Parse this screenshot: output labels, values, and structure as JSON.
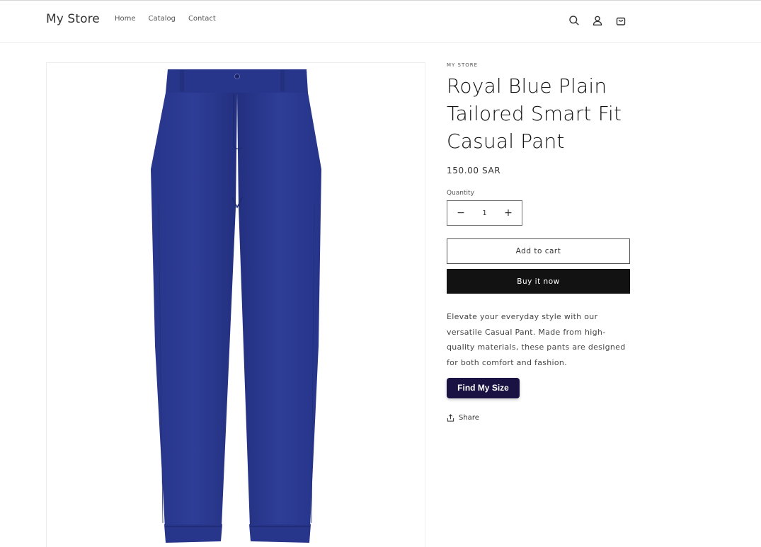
{
  "header": {
    "store_name": "My Store",
    "nav": [
      "Home",
      "Catalog",
      "Contact"
    ],
    "icons": [
      "search-icon",
      "account-icon",
      "cart-icon"
    ]
  },
  "product": {
    "vendor": "MY STORE",
    "title": "Royal Blue Plain Tailored Smart Fit Casual Pant",
    "price": "150.00 SAR",
    "quantity_label": "Quantity",
    "quantity_value": "1",
    "decrease_symbol": "−",
    "increase_symbol": "+",
    "add_to_cart_label": "Add to cart",
    "buy_now_label": "Buy it now",
    "description": "Elevate your everyday style with our versatile Casual Pant. Made from high-quality materials, these pants are designed for both comfort and fashion.",
    "find_size_label": "Find My Size",
    "share_label": "Share",
    "image_color": "#2b3a8c"
  },
  "colors": {
    "buy_button": "#121212",
    "find_size_button": "#1b1244",
    "pant_blue": "#2b3a8c"
  }
}
